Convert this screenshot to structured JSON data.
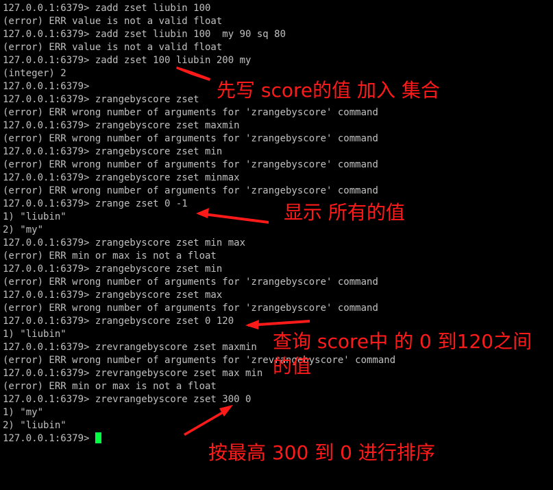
{
  "colors": {
    "background": "#000000",
    "text": "#c0c0c0",
    "cursor": "#00ff41",
    "annotation": "#ff1a1a"
  },
  "terminal": {
    "lines": [
      "127.0.0.1:6379> zadd zset liubin 100",
      "(error) ERR value is not a valid float",
      "127.0.0.1:6379> zadd zset liubin 100  my 90 sq 80",
      "(error) ERR value is not a valid float",
      "127.0.0.1:6379> zadd zset 100 liubin 200 my",
      "(integer) 2",
      "127.0.0.1:6379>",
      "127.0.0.1:6379> zrangebyscore zset",
      "(error) ERR wrong number of arguments for 'zrangebyscore' command",
      "127.0.0.1:6379> zrangebyscore zset maxmin",
      "(error) ERR wrong number of arguments for 'zrangebyscore' command",
      "127.0.0.1:6379> zrangebyscore zset min",
      "(error) ERR wrong number of arguments for 'zrangebyscore' command",
      "127.0.0.1:6379> zrangebyscore zset minmax",
      "(error) ERR wrong number of arguments for 'zrangebyscore' command",
      "127.0.0.1:6379> zrange zset 0 -1",
      "1) \"liubin\"",
      "2) \"my\"",
      "127.0.0.1:6379> zrangebyscore zset min max",
      "(error) ERR min or max is not a float",
      "127.0.0.1:6379> zrangebyscore zset min",
      "(error) ERR wrong number of arguments for 'zrangebyscore' command",
      "127.0.0.1:6379> zrangebyscore zset max",
      "(error) ERR wrong number of arguments for 'zrangebyscore' command",
      "127.0.0.1:6379> zrangebyscore zset 0 120",
      "1) \"liubin\"",
      "127.0.0.1:6379> zrevrangebyscore zset maxmin",
      "(error) ERR wrong number of arguments for 'zrevrangebyscore' command",
      "127.0.0.1:6379> zrevrangebyscore zset max min",
      "(error) ERR min or max is not a float",
      "127.0.0.1:6379> zrevrangebyscore zset 300 0",
      "1) \"my\"",
      "2) \"liubin\""
    ],
    "prompt": "127.0.0.1:6379> "
  },
  "annotations": {
    "add_to_set": "先写 score的值 加入 集合",
    "show_all": "显示 所有的值",
    "query_range": "查询 score中 的 0 到120之间的值",
    "sort_desc": "按最高 300 到 0 进行排序"
  }
}
